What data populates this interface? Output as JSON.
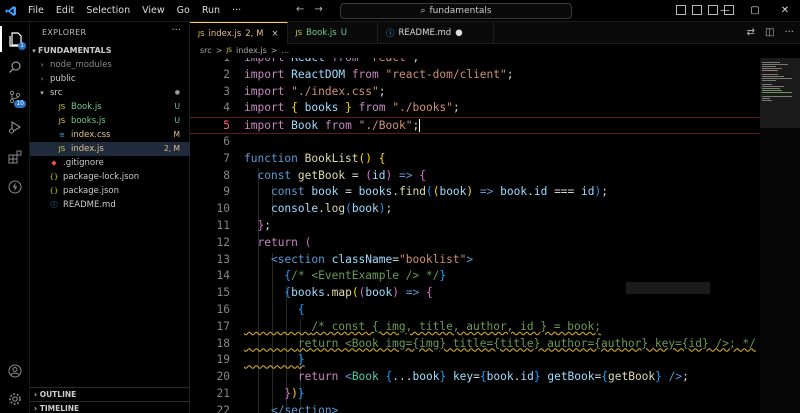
{
  "titlebar": {
    "menu": [
      "File",
      "Edit",
      "Selection",
      "View",
      "Go",
      "Run"
    ],
    "more": "···",
    "search": "fundamentals"
  },
  "activity": {
    "source_control_badge": "10",
    "explorer_badge": "1"
  },
  "sidebar": {
    "header": "EXPLORER",
    "root": "FUNDAMENTALS",
    "items": [
      {
        "label": "node_modules",
        "status": ""
      },
      {
        "label": "public",
        "status": ""
      },
      {
        "label": "src",
        "status": "●"
      },
      {
        "label": "Book.js",
        "status": "U"
      },
      {
        "label": "books.js",
        "status": "U"
      },
      {
        "label": "index.css",
        "status": "M"
      },
      {
        "label": "index.js",
        "status": "2, M"
      },
      {
        "label": ".gitignore",
        "status": ""
      },
      {
        "label": "package-lock.json",
        "status": ""
      },
      {
        "label": "package.json",
        "status": ""
      },
      {
        "label": "README.md",
        "status": ""
      }
    ],
    "outline": "OUTLINE",
    "timeline": "TIMELINE"
  },
  "tabs": [
    {
      "label": "index.js",
      "status": "2, M",
      "close": "×"
    },
    {
      "label": "Book.js",
      "status": "U"
    },
    {
      "label": "README.md",
      "status": "●"
    }
  ],
  "breadcrumb": [
    "src",
    ">",
    "index.js",
    ">",
    "..."
  ],
  "colors": {
    "accent": "#3ca0ff",
    "modified": "#e2c08d",
    "untracked": "#73c991",
    "keyword": "#569cd6",
    "string": "#ce9178",
    "comment": "#6a9955"
  },
  "lines": [
    "1",
    "2",
    "3",
    "4",
    "5",
    "6",
    "7",
    "8",
    "9",
    "10",
    "11",
    "12",
    "13",
    "14",
    "15",
    "16",
    "17",
    "18",
    "19",
    "20",
    "21",
    "22"
  ]
}
